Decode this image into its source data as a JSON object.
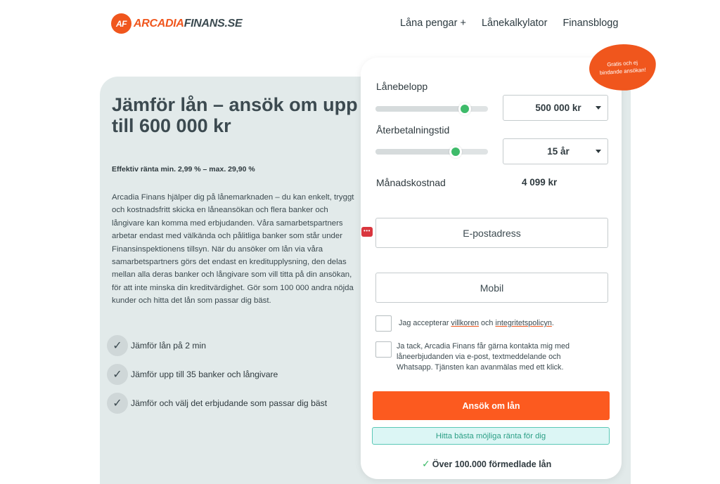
{
  "header": {
    "logo_badge": "AF",
    "logo_brand": "ARCADIA",
    "logo_tld": "FINANS.SE",
    "nav": [
      "Låna pengar +",
      "Lånekalkylator",
      "Finansblogg"
    ]
  },
  "hero": {
    "title": "Jämför lån – ansök om upp till 600 000 kr",
    "rate_text": "Effektiv ränta min. 2,99 % – max. 29,90 %",
    "description": "Arcadia Finans hjälper dig på lånemarknaden – du kan enkelt, tryggt och kostnadsfritt skicka en låneansökan och flera banker och långivare kan komma med erbjudanden. Våra samarbetspartners arbetar endast med välkända och pålitliga banker som står under Finansinspektionens tillsyn. När du ansöker om lån via våra samarbetspartners görs det endast en kreditupplysning, den delas mellan alla deras banker och långivare som vill titta på din ansökan, för att inte minska din kreditvärdighet. Gör som 100 000 andra nöjda kunder och hitta det lån som passar dig bäst.",
    "checklist": [
      "Jämför lån på 2 min",
      "Jämför upp till 35 banker och långivare",
      "Jämför och välj det erbjudande som passar dig bäst"
    ]
  },
  "form": {
    "badge": "Gratis och ej bindande ansökan!",
    "loan_amount_label": "Lånebelopp",
    "loan_amount_value": "500 000 kr",
    "loan_amount_slider_fraction": 0.83,
    "term_label": "Återbetalningstid",
    "term_value": "15 år",
    "term_slider_fraction": 0.74,
    "monthly_cost_label": "Månadskostnad",
    "monthly_cost_value": "4 099 kr",
    "email_placeholder": "E-postadress",
    "mobile_placeholder": "Mobil",
    "terms_prefix": "Jag accepterar ",
    "terms_link": "villkoren",
    "terms_mid": " och ",
    "privacy_link": "integritetspolicyn",
    "terms_suffix": ".",
    "contact_consent": "Ja tack, Arcadia Finans får gärna kontakta mig med låneerbjudanden via e-post, textmeddelande och Whatsapp. Tjänsten kan avanmälas med ett klick.",
    "apply_button": "Ansök om lån",
    "rate_button": "Hitta bästa möjliga ränta för dig",
    "footer_tick": "✓",
    "footer_note": "Över 100.000 förmedlade lån"
  },
  "colors": {
    "brand": "#f0561d",
    "accent_green": "#3ebb6a",
    "panel_bg": "#e2eaea"
  },
  "icons": {
    "check": "✓",
    "password_manager": "•••"
  }
}
